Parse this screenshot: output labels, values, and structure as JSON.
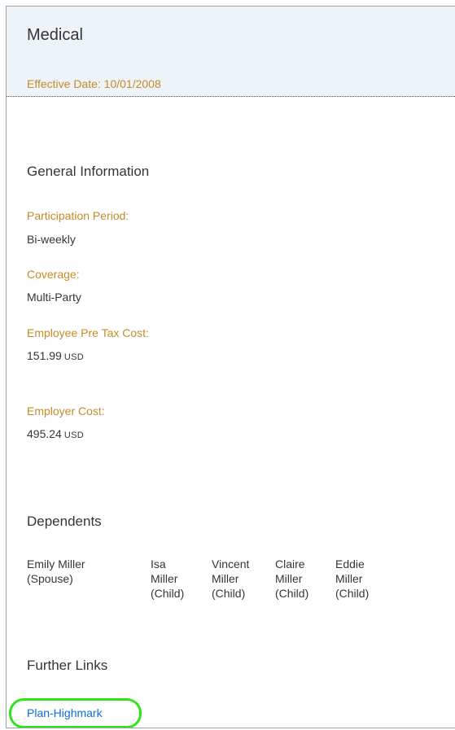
{
  "header": {
    "title": "Medical",
    "effective_date": "Effective Date: 10/01/2008"
  },
  "general": {
    "title": "General Information",
    "participation_label": "Participation Period:",
    "participation_value": "Bi-weekly",
    "coverage_label": "Coverage:",
    "coverage_value": "Multi-Party",
    "employee_cost_label": "Employee Pre Tax Cost:",
    "employee_cost_value": "151.99",
    "employee_cost_unit": "USD",
    "employer_cost_label": "Employer Cost:",
    "employer_cost_value": "495.24",
    "employer_cost_unit": "USD"
  },
  "dependents": {
    "title": "Dependents",
    "items": [
      {
        "line1": "Emily Miller",
        "line2": "(Spouse)",
        "line3": ""
      },
      {
        "line1": "Isa",
        "line2": "Miller",
        "line3": "(Child)"
      },
      {
        "line1": "Vincent",
        "line2": "Miller",
        "line3": "(Child)"
      },
      {
        "line1": "Claire",
        "line2": "Miller",
        "line3": "(Child)"
      },
      {
        "line1": "Eddie",
        "line2": "Miller",
        "line3": "(Child)"
      }
    ]
  },
  "further_links": {
    "title": "Further Links",
    "link_label": "Plan-Highmark"
  },
  "colors": {
    "label_accent": "#c38c2a",
    "link": "#0a6ed1",
    "highlight": "#2ee51c",
    "header_bg": "#eef3f8"
  }
}
